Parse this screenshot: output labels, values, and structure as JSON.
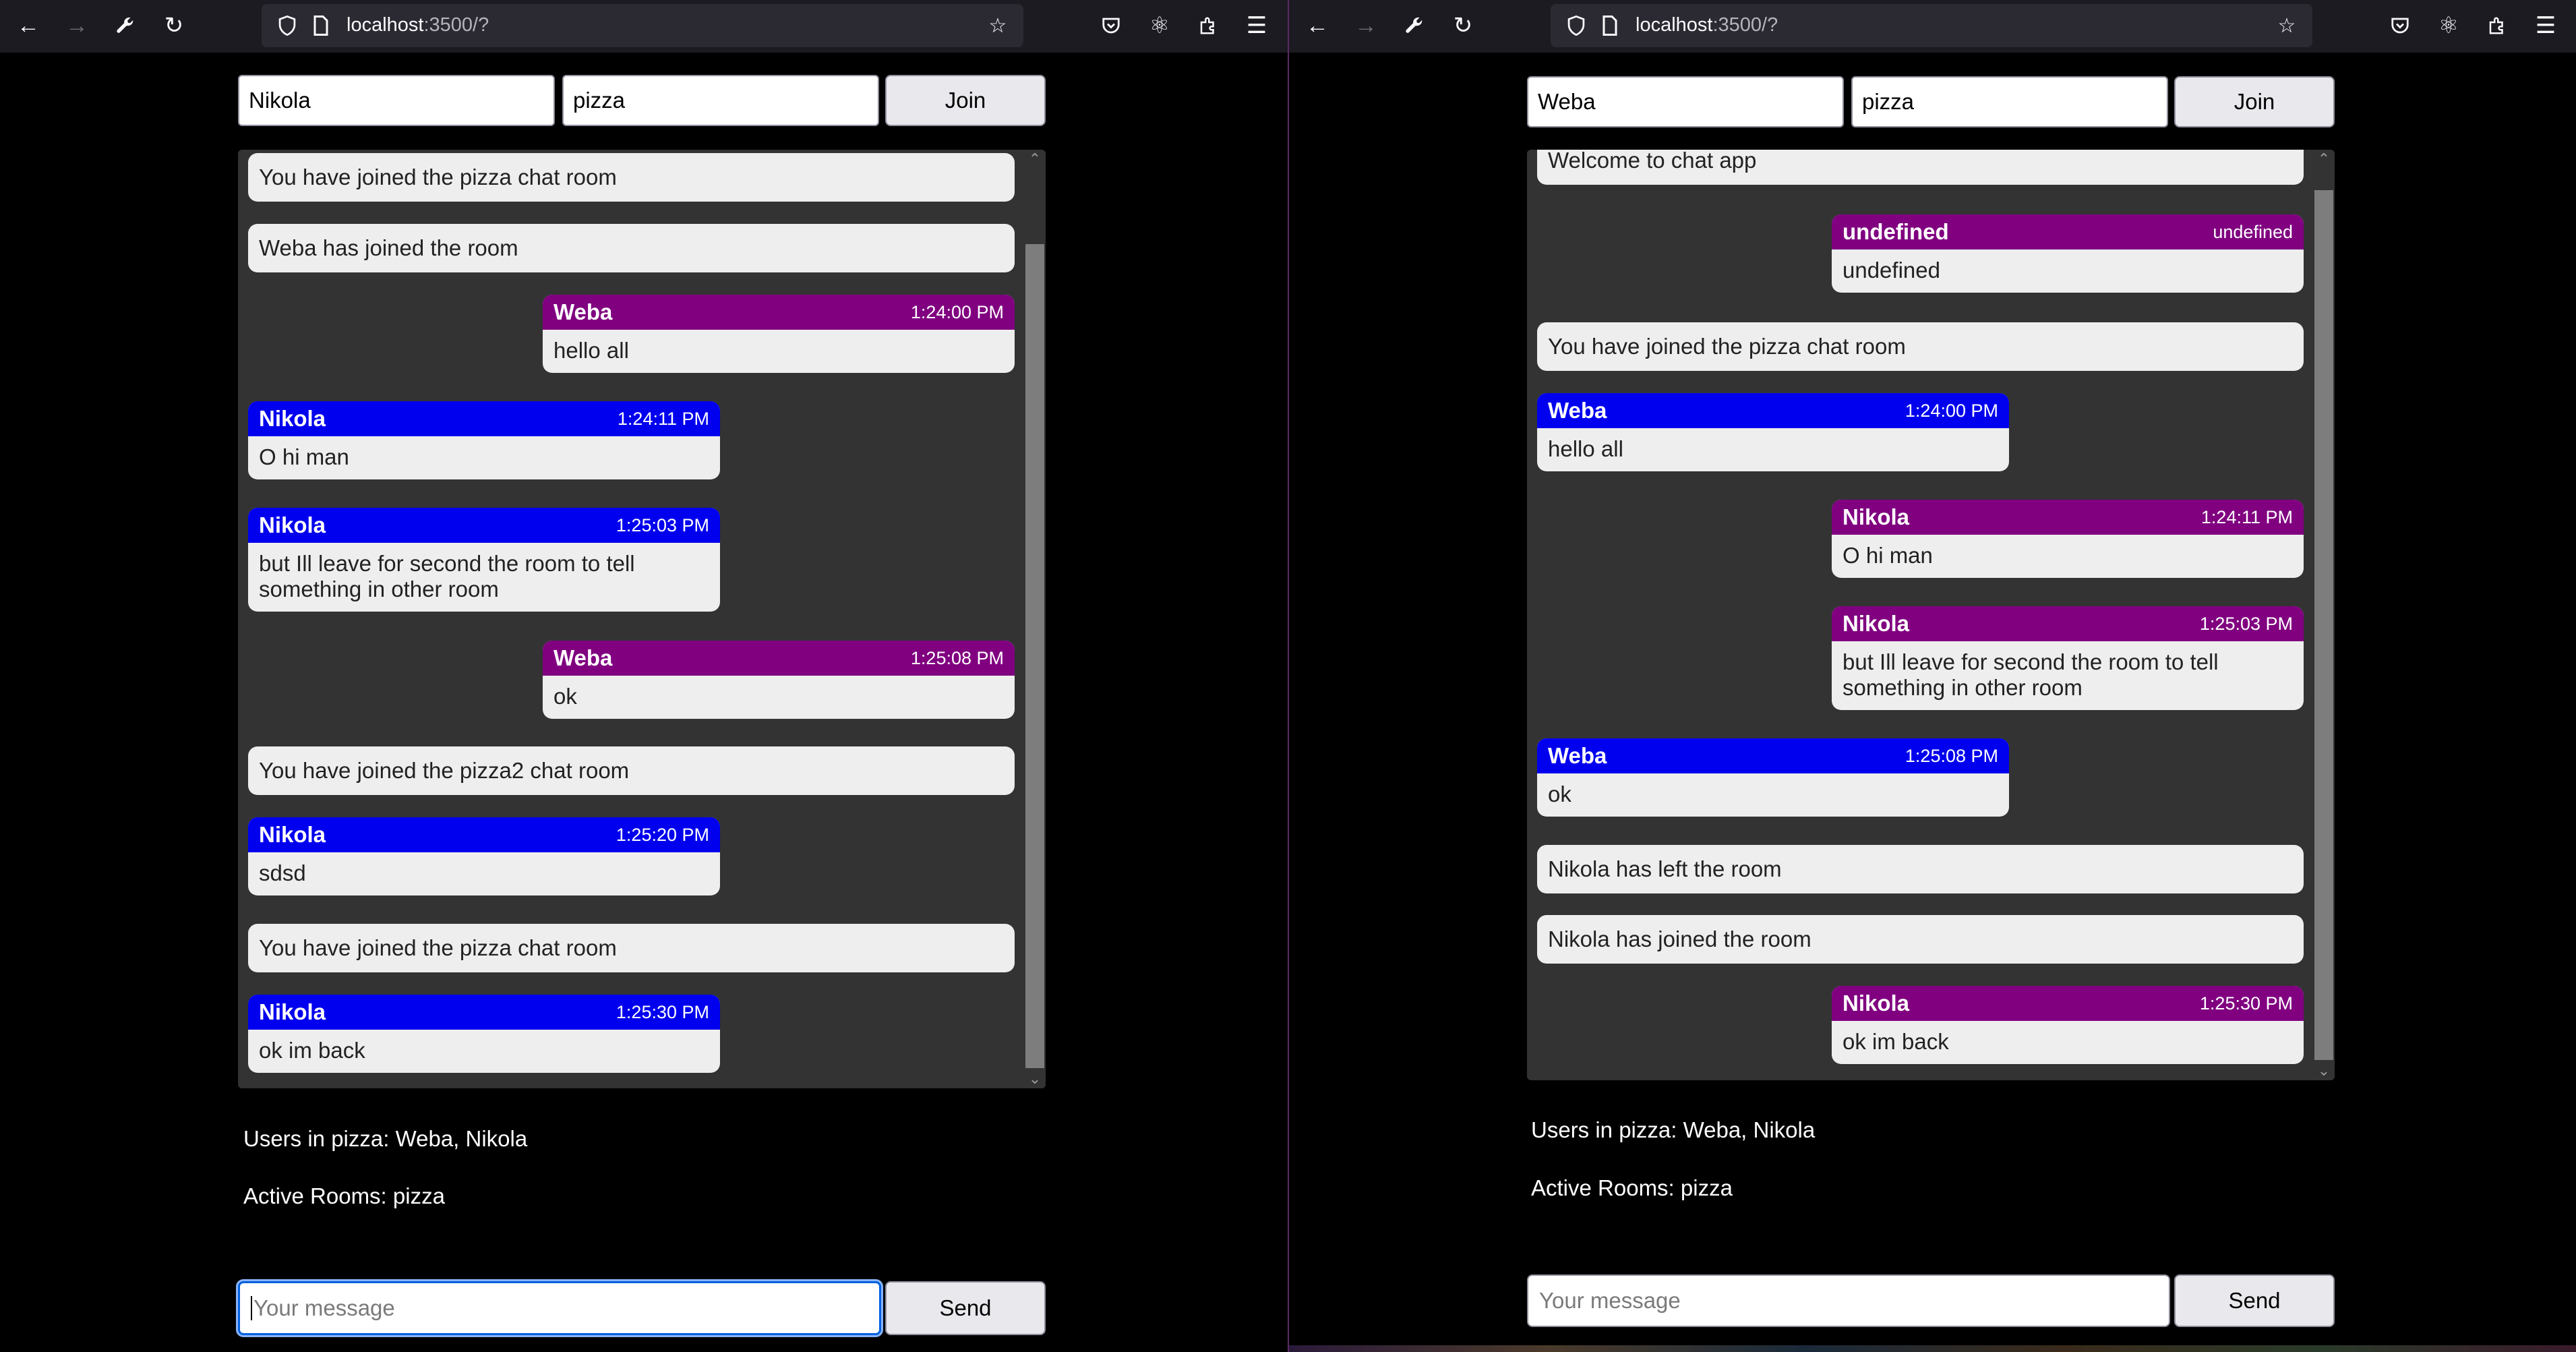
{
  "browser": {
    "url_host": "localhost",
    "url_rest": ":3500/?",
    "icons": [
      "back-icon",
      "forward-icon",
      "wrench-icon",
      "reload-icon",
      "shield-icon",
      "page-icon",
      "star-icon",
      "pocket-icon",
      "react-devtools-icon",
      "extensions-icon",
      "menu-icon"
    ]
  },
  "colors": {
    "own_header": "#800080",
    "other_header": "#0000ee",
    "chat_bg": "#333333",
    "bubble_bg": "#eeeeee"
  },
  "left": {
    "name_value": "Nikola",
    "room_value": "pizza",
    "join_label": "Join",
    "messages": [
      {
        "type": "system",
        "text": "You have joined the pizza chat room"
      },
      {
        "type": "system",
        "text": "Weba has joined the room"
      },
      {
        "type": "message",
        "side": "right",
        "color": "purple",
        "name": "Weba",
        "time": "1:24:00 PM",
        "text": "hello all"
      },
      {
        "type": "message",
        "side": "left",
        "color": "blue",
        "name": "Nikola",
        "time": "1:24:11 PM",
        "text": "O hi man"
      },
      {
        "type": "message",
        "side": "left",
        "color": "blue",
        "name": "Nikola",
        "time": "1:25:03 PM",
        "text": "but Ill leave for second the room to tell something in other room"
      },
      {
        "type": "message",
        "side": "right",
        "color": "purple",
        "name": "Weba",
        "time": "1:25:08 PM",
        "text": "ok"
      },
      {
        "type": "system",
        "text": "You have joined the pizza2 chat room"
      },
      {
        "type": "message",
        "side": "left",
        "color": "blue",
        "name": "Nikola",
        "time": "1:25:20 PM",
        "text": "sdsd"
      },
      {
        "type": "system",
        "text": "You have joined the pizza chat room"
      },
      {
        "type": "message",
        "side": "left",
        "color": "blue",
        "name": "Nikola",
        "time": "1:25:30 PM",
        "text": "ok im back"
      }
    ],
    "users_text": "Users in pizza: Weba, Nikola",
    "rooms_text": "Active Rooms: pizza",
    "message_placeholder": "Your message",
    "send_label": "Send"
  },
  "right": {
    "name_value": "Weba",
    "room_value": "pizza",
    "join_label": "Join",
    "messages": [
      {
        "type": "system",
        "text": "Welcome to chat app"
      },
      {
        "type": "message",
        "side": "right",
        "color": "purple",
        "name": "undefined",
        "time": "undefined",
        "text": "undefined"
      },
      {
        "type": "system",
        "text": "You have joined the pizza chat room"
      },
      {
        "type": "message",
        "side": "left",
        "color": "blue",
        "name": "Weba",
        "time": "1:24:00 PM",
        "text": "hello all"
      },
      {
        "type": "message",
        "side": "right",
        "color": "purple",
        "name": "Nikola",
        "time": "1:24:11 PM",
        "text": "O hi man"
      },
      {
        "type": "message",
        "side": "right",
        "color": "purple",
        "name": "Nikola",
        "time": "1:25:03 PM",
        "text": "but Ill leave for second the room to tell something in other room"
      },
      {
        "type": "message",
        "side": "left",
        "color": "blue",
        "name": "Weba",
        "time": "1:25:08 PM",
        "text": "ok"
      },
      {
        "type": "system",
        "text": "Nikola has left the room"
      },
      {
        "type": "system",
        "text": "Nikola has joined the room"
      },
      {
        "type": "message",
        "side": "right",
        "color": "purple",
        "name": "Nikola",
        "time": "1:25:30 PM",
        "text": "ok im back"
      }
    ],
    "users_text": "Users in pizza: Weba, Nikola",
    "rooms_text": "Active Rooms: pizza",
    "message_placeholder": "Your message",
    "send_label": "Send"
  }
}
